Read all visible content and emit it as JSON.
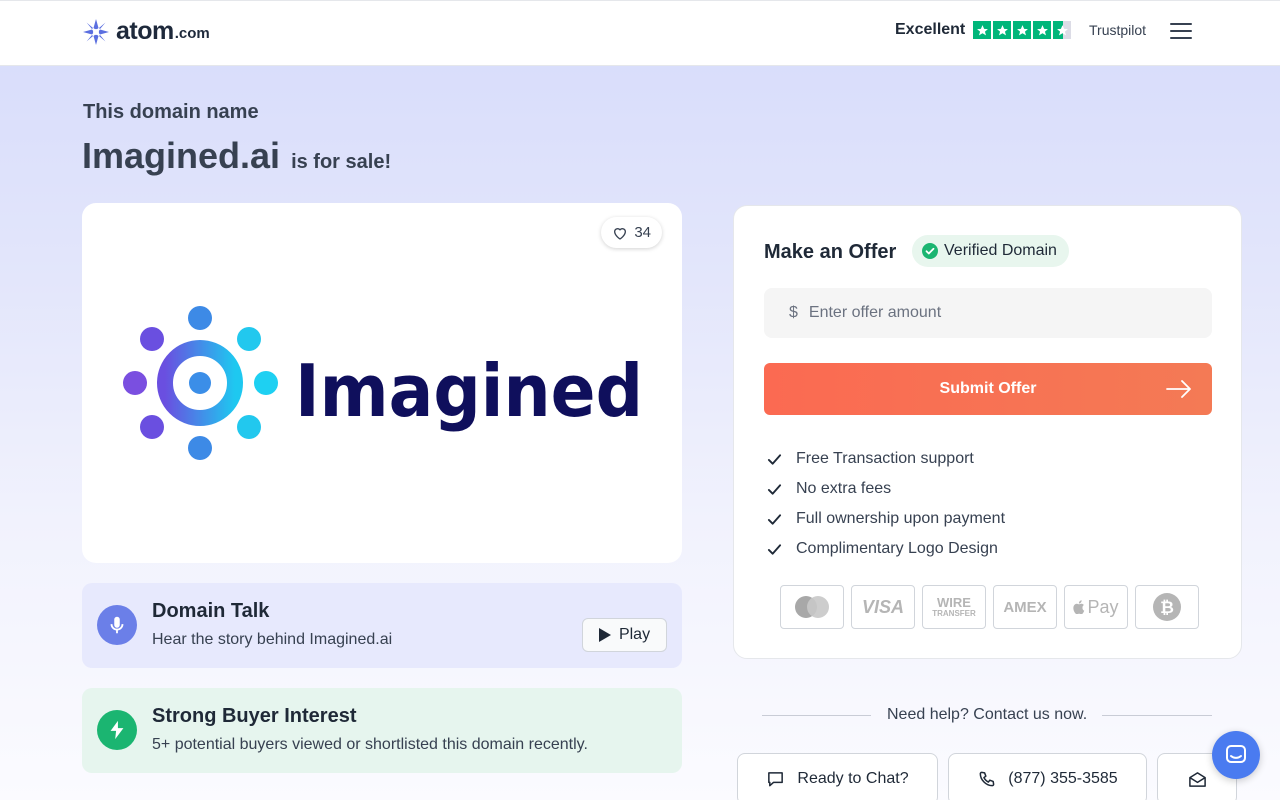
{
  "header": {
    "logo_word": "atom",
    "logo_domain": ".com",
    "trust_label": "Excellent",
    "trust_brand": "Trustpilot",
    "trust_rating": 4.5,
    "trust_color": "#00b67a",
    "menu_icon": "hamburger-menu-icon"
  },
  "hero": {
    "eyebrow": "This domain name",
    "domain": "Imagined.ai",
    "for_sale": "is for sale!"
  },
  "logo_card": {
    "likes": "34",
    "brand_text": "Imagined",
    "brand_color": "#0f0f5c"
  },
  "domain_talk": {
    "title": "Domain Talk",
    "subtitle": "Hear the story behind Imagined.ai",
    "play_label": "Play",
    "icon": "microphone-icon"
  },
  "buyer_interest": {
    "title": "Strong Buyer Interest",
    "subtitle": "5+ potential buyers viewed or shortlisted this domain recently.",
    "icon": "lightning-icon"
  },
  "offer": {
    "title": "Make an Offer",
    "verified_label": "Verified Domain",
    "currency_symbol": "$",
    "input_placeholder": "Enter offer amount",
    "submit_label": "Submit Offer",
    "accent_color": "#fb6a52",
    "benefits": [
      "Free Transaction support",
      "No extra fees",
      "Full ownership upon payment",
      "Complimentary Logo Design"
    ],
    "payment_methods": {
      "visa": "VISA",
      "wire_top": "WIRE",
      "wire_bottom": "TRANSFER",
      "amex": "AMEX",
      "apple_pay": "Pay"
    }
  },
  "help": {
    "text": "Need help? Contact us now.",
    "chat_label": "Ready to Chat?",
    "phone": "(877) 355-3585"
  }
}
